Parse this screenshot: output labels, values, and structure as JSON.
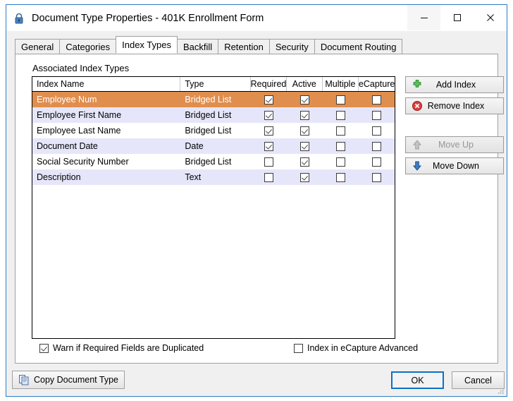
{
  "window": {
    "title": "Document Type Properties  - 401K Enrollment Form",
    "lock_icon": "lock-icon",
    "caption": {
      "minimize": "—",
      "maximize": "☐",
      "close": "✕",
      "minimize_name": "minimize-button",
      "maximize_name": "maximize-button",
      "close_name": "close-button"
    }
  },
  "tabs": [
    {
      "label": "General",
      "selected": false
    },
    {
      "label": "Categories",
      "selected": false
    },
    {
      "label": "Index Types",
      "selected": true
    },
    {
      "label": "Backfill",
      "selected": false
    },
    {
      "label": "Retention",
      "selected": false
    },
    {
      "label": "Security",
      "selected": false
    },
    {
      "label": "Document Routing",
      "selected": false
    }
  ],
  "page": {
    "section_label": "Associated Index Types"
  },
  "grid": {
    "columns": [
      "Index Name",
      "Type",
      "Required",
      "Active",
      "Multiple",
      "eCapture"
    ],
    "rows": [
      {
        "name": "Employee Num",
        "type": "Bridged List",
        "required": true,
        "active": true,
        "multiple": false,
        "ecapture": false,
        "selected": true
      },
      {
        "name": "Employee First Name",
        "type": "Bridged List",
        "required": true,
        "active": true,
        "multiple": false,
        "ecapture": false,
        "selected": false
      },
      {
        "name": "Employee Last Name",
        "type": "Bridged List",
        "required": true,
        "active": true,
        "multiple": false,
        "ecapture": false,
        "selected": false
      },
      {
        "name": "Document Date",
        "type": "Date",
        "required": true,
        "active": true,
        "multiple": false,
        "ecapture": false,
        "selected": false
      },
      {
        "name": "Social Security Number",
        "type": "Bridged List",
        "required": false,
        "active": true,
        "multiple": false,
        "ecapture": false,
        "selected": false
      },
      {
        "name": "Description",
        "type": "Text",
        "required": false,
        "active": true,
        "multiple": false,
        "ecapture": false,
        "selected": false
      }
    ]
  },
  "side_buttons": [
    {
      "label": "Add Index",
      "icon": "green-plus-icon",
      "disabled": false
    },
    {
      "label": "Remove Index",
      "icon": "red-delete-icon",
      "disabled": false
    },
    {
      "label": "Move Up",
      "icon": "gray-up-arrow-icon",
      "disabled": true
    },
    {
      "label": "Move Down",
      "icon": "blue-down-arrow-icon",
      "disabled": false
    }
  ],
  "options": {
    "warn_duplicate": {
      "label": "Warn if Required Fields are Duplicated",
      "checked": true
    },
    "index_ecapture": {
      "label": "Index in eCapture Advanced",
      "checked": false
    }
  },
  "footer": {
    "copy": {
      "label": "Copy Document Type",
      "icon": "copy-documents-icon"
    },
    "ok": "OK",
    "cancel": "Cancel"
  },
  "colors": {
    "window_border": "#2f7dc4",
    "selected_row": "#e08e4e",
    "alt_row": "#e6e6fa",
    "focus_border": "#0a72c8"
  }
}
